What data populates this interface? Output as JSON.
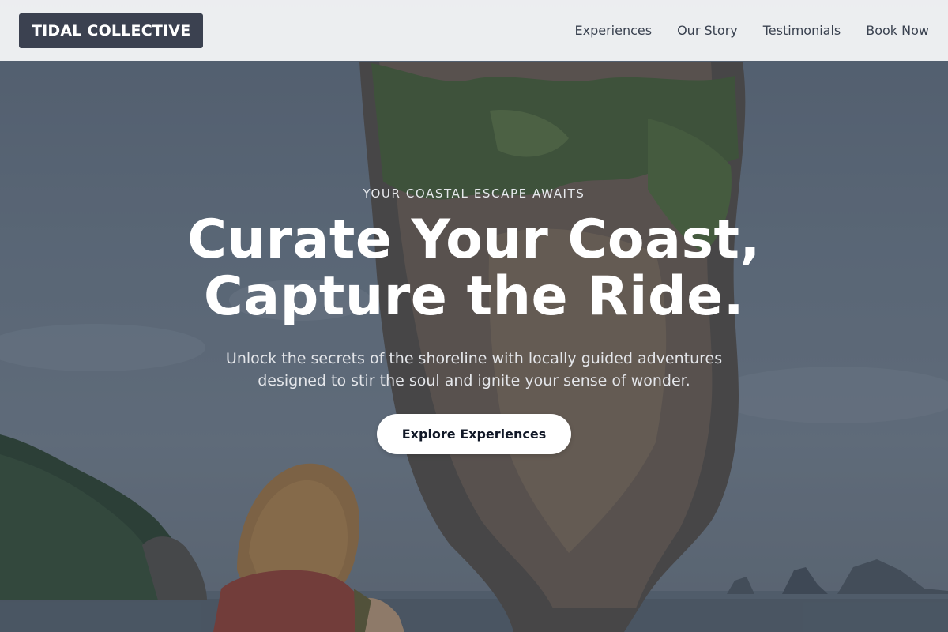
{
  "header": {
    "logo": "TIDAL COLLECTIVE",
    "nav": [
      {
        "label": "Experiences"
      },
      {
        "label": "Our Story"
      },
      {
        "label": "Testimonials"
      },
      {
        "label": "Book Now"
      }
    ]
  },
  "hero": {
    "eyebrow": "YOUR COASTAL ESCAPE AWAITS",
    "headline_line1": "Curate Your Coast,",
    "headline_line2": "Capture the Ride.",
    "subtext": "Unlock the secrets of the shoreline with locally guided adventures designed to stir the soul and ignite your sense of wonder.",
    "cta_label": "Explore Experiences"
  },
  "colors": {
    "header_bg": "#f3f4f6",
    "logo_bg": "#3b4150",
    "cta_bg": "#ffffff",
    "cta_text": "#111827"
  }
}
